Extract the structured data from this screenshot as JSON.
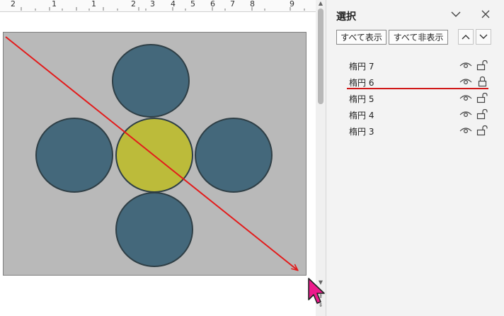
{
  "ruler": {
    "labels": [
      "2",
      "1",
      "1",
      "2",
      "3",
      "4",
      "5",
      "6",
      "7",
      "8",
      "9"
    ]
  },
  "pane": {
    "title": "選択",
    "show_all": "すべて表示",
    "hide_all": "すべて非表示",
    "items": [
      {
        "label": "楕円 7",
        "visible": true,
        "locked": false
      },
      {
        "label": "楕円 6",
        "visible": true,
        "locked": true
      },
      {
        "label": "楕円 5",
        "visible": true,
        "locked": false
      },
      {
        "label": "楕円 4",
        "visible": true,
        "locked": false
      },
      {
        "label": "楕円 3",
        "visible": true,
        "locked": false
      }
    ]
  },
  "colors": {
    "slide_bg": "#b9b9b9",
    "circle_blue": "#44687b",
    "circle_yellow": "#bcbb3a",
    "annotation_red": "#e31b1b",
    "cursor_magenta": "#ec1a8c"
  }
}
